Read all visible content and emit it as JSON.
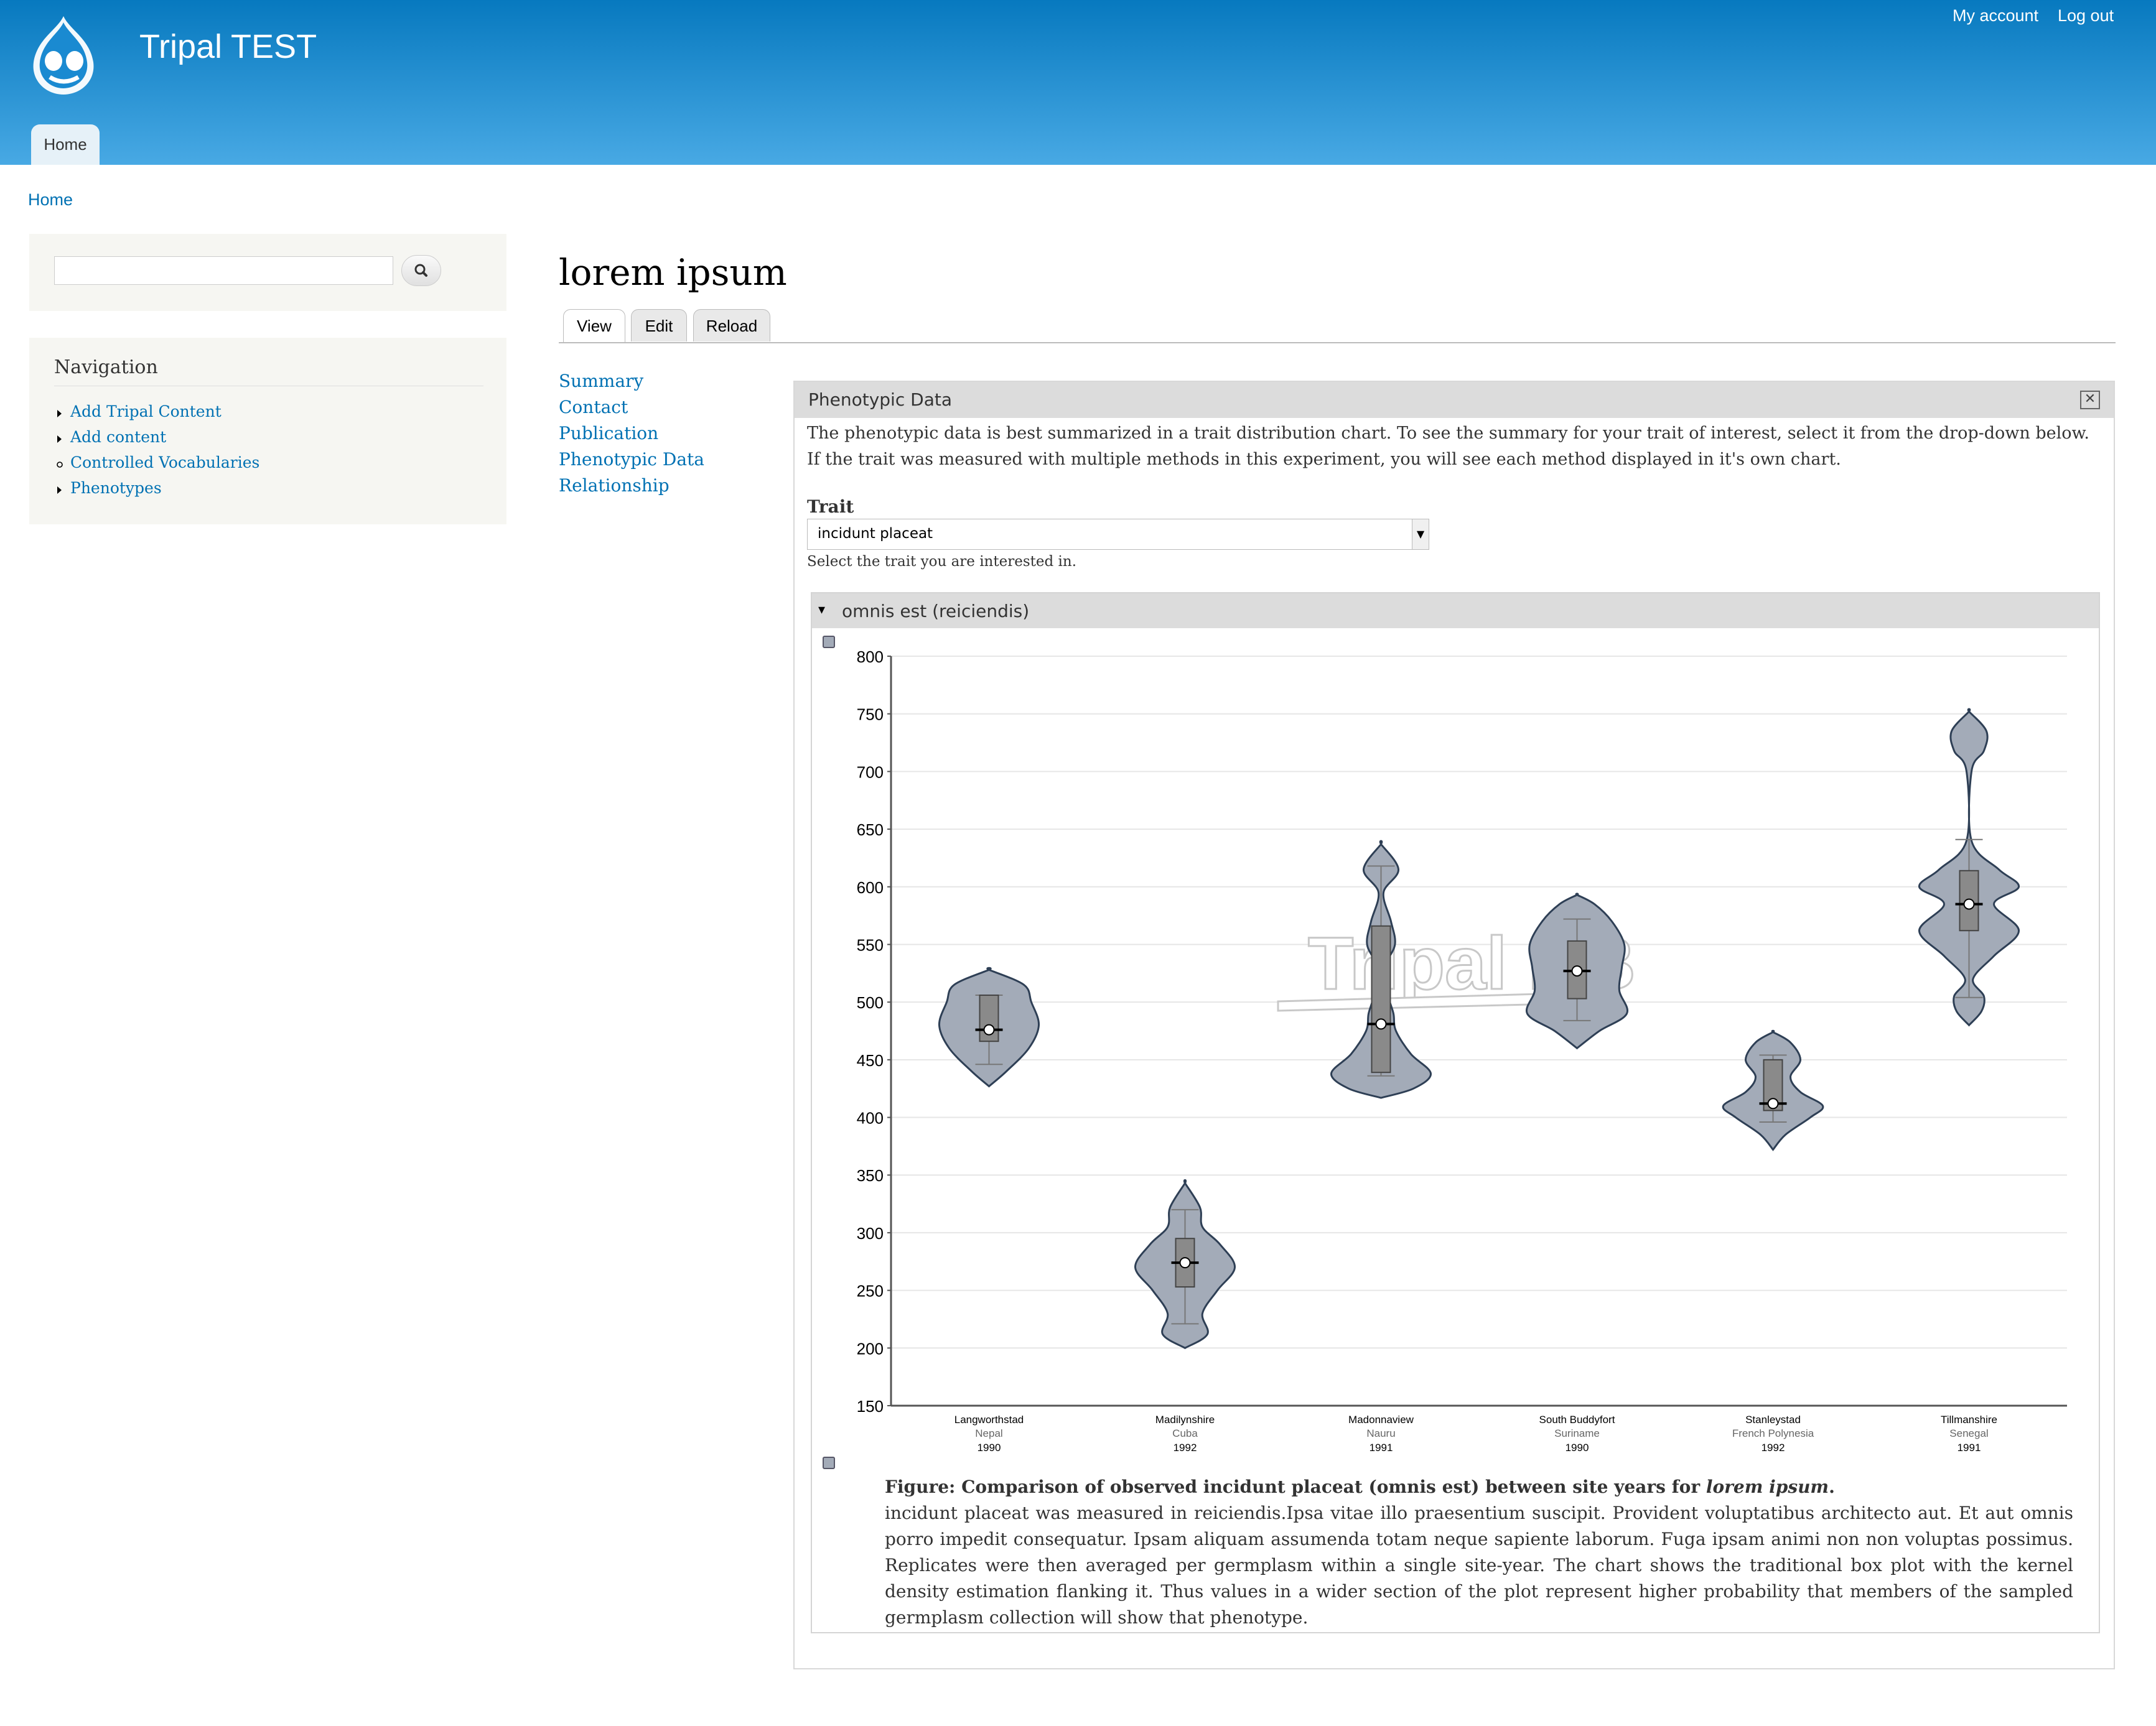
{
  "site": {
    "name": "Tripal TEST"
  },
  "user_menu": {
    "account": "My account",
    "logout": "Log out"
  },
  "main_menu": {
    "home": "Home"
  },
  "breadcrumb": {
    "home": "Home"
  },
  "sidebar": {
    "navigation_title": "Navigation",
    "items": [
      {
        "label": "Add Tripal Content",
        "marker": "triangle"
      },
      {
        "label": "Add content",
        "marker": "triangle"
      },
      {
        "label": "Controlled Vocabularies",
        "marker": "circle"
      },
      {
        "label": "Phenotypes",
        "marker": "triangle"
      }
    ]
  },
  "page": {
    "title": "lorem ipsum",
    "tabs": [
      "View",
      "Edit",
      "Reload"
    ],
    "toc": [
      "Summary",
      "Contact",
      "Publication",
      "Phenotypic Data",
      "Relationship"
    ]
  },
  "pane": {
    "title": "Phenotypic Data",
    "intro": "The phenotypic data is best summarized in a trait distribution chart. To see the summary for your trait of interest, select it from the drop-down below. If the trait was measured with multiple methods in this experiment, you will see each method displayed in it's own chart.",
    "trait_label": "Trait",
    "trait_value": "incidunt placeat",
    "trait_help": "Select the trait you are interested in.",
    "fieldset_title": "omnis est (reiciendis)",
    "watermark": "Tripal DB"
  },
  "figure": {
    "caption_title": "Figure: Comparison of observed incidunt placeat (omnis est) between site years for ",
    "caption_title_em": "lorem ipsum",
    "caption_title_end": ".",
    "caption_body": "incidunt placeat was measured in reiciendis.Ipsa vitae illo praesentium suscipit. Provident voluptatibus architecto aut. Et aut omnis porro impedit consequatur. Ipsam aliquam assumenda totam neque sapiente laborum. Fuga ipsam animi non non voluptas possimus. Replicates were then averaged per germplasm within a single site-year. The chart shows the traditional box plot with the kernel density estimation flanking it. Thus values in a wider section of the plot represent higher probability that members of the sampled germplasm collection will show that phenotype."
  },
  "colors": {
    "header_top": "#0779bf",
    "header_bottom": "#48a9e4",
    "link": "#0071b3",
    "violin_fill": "#a3abb8",
    "violin_stroke": "#2e3f55"
  },
  "chart_data": {
    "type": "violin",
    "ylim": [
      150,
      800
    ],
    "yticks": [
      150,
      200,
      250,
      300,
      350,
      400,
      450,
      500,
      550,
      600,
      650,
      700,
      750,
      800
    ],
    "grid": true,
    "categories": [
      {
        "site": "Langworthstad",
        "country": "Nepal",
        "year": "1990",
        "min": 427,
        "max": 528,
        "whisker_low": 446,
        "whisker_high": 506,
        "q1": 466,
        "q3": 506,
        "median": 476,
        "mean": 476,
        "density": [
          [
            427,
            0
          ],
          [
            440,
            0.35
          ],
          [
            460,
            0.8
          ],
          [
            480,
            1
          ],
          [
            500,
            0.85
          ],
          [
            515,
            0.7
          ],
          [
            528,
            0
          ]
        ]
      },
      {
        "site": "Madilynshire",
        "country": "Cuba",
        "year": "1992",
        "min": 200,
        "max": 343,
        "whisker_low": 221,
        "whisker_high": 320,
        "q1": 253,
        "q3": 295,
        "median": 274,
        "mean": 274,
        "density": [
          [
            200,
            0
          ],
          [
            212,
            0.45
          ],
          [
            230,
            0.35
          ],
          [
            250,
            0.65
          ],
          [
            270,
            1
          ],
          [
            290,
            0.7
          ],
          [
            305,
            0.35
          ],
          [
            322,
            0.3
          ],
          [
            343,
            0
          ]
        ]
      },
      {
        "site": "Madonnaview",
        "country": "Nauru",
        "year": "1991",
        "min": 417,
        "max": 637,
        "whisker_low": 436,
        "whisker_high": 618,
        "q1": 439,
        "q3": 566,
        "median": 481,
        "mean": 481,
        "density": [
          [
            417,
            0
          ],
          [
            425,
            0.65
          ],
          [
            438,
            1
          ],
          [
            455,
            0.6
          ],
          [
            475,
            0.3
          ],
          [
            490,
            0.25
          ],
          [
            505,
            0.15
          ],
          [
            530,
            0.08
          ],
          [
            550,
            0.28
          ],
          [
            570,
            0.2
          ],
          [
            595,
            0.05
          ],
          [
            615,
            0.35
          ],
          [
            637,
            0
          ]
        ]
      },
      {
        "site": "South Buddyfort",
        "country": "Suriname",
        "year": "1990",
        "min": 460,
        "max": 593,
        "whisker_low": 484,
        "whisker_high": 572,
        "q1": 503,
        "q3": 553,
        "median": 527,
        "mean": 527,
        "density": [
          [
            460,
            0
          ],
          [
            475,
            0.45
          ],
          [
            490,
            1
          ],
          [
            510,
            0.85
          ],
          [
            530,
            0.9
          ],
          [
            550,
            0.95
          ],
          [
            570,
            0.7
          ],
          [
            585,
            0.35
          ],
          [
            593,
            0
          ]
        ]
      },
      {
        "site": "Stanleystad",
        "country": "French Polynesia",
        "year": "1992",
        "min": 372,
        "max": 474,
        "whisker_low": 396,
        "whisker_high": 454,
        "q1": 406,
        "q3": 450,
        "median": 412,
        "mean": 412,
        "density": [
          [
            372,
            0
          ],
          [
            385,
            0.25
          ],
          [
            400,
            0.75
          ],
          [
            410,
            1
          ],
          [
            422,
            0.55
          ],
          [
            435,
            0.35
          ],
          [
            450,
            0.55
          ],
          [
            465,
            0.35
          ],
          [
            474,
            0
          ]
        ]
      },
      {
        "site": "Tillmanshire",
        "country": "Senegal",
        "year": "1991",
        "min": 480,
        "max": 752,
        "whisker_low": 504,
        "whisker_high": 641,
        "q1": 562,
        "q3": 614,
        "median": 585,
        "mean": 585,
        "density": [
          [
            480,
            0
          ],
          [
            492,
            0.25
          ],
          [
            505,
            0.3
          ],
          [
            520,
            0.08
          ],
          [
            540,
            0.5
          ],
          [
            562,
            1
          ],
          [
            585,
            0.5
          ],
          [
            600,
            1
          ],
          [
            615,
            0.6
          ],
          [
            640,
            0.05
          ],
          [
            700,
            0.05
          ],
          [
            718,
            0.3
          ],
          [
            735,
            0.35
          ],
          [
            752,
            0
          ]
        ]
      }
    ]
  }
}
